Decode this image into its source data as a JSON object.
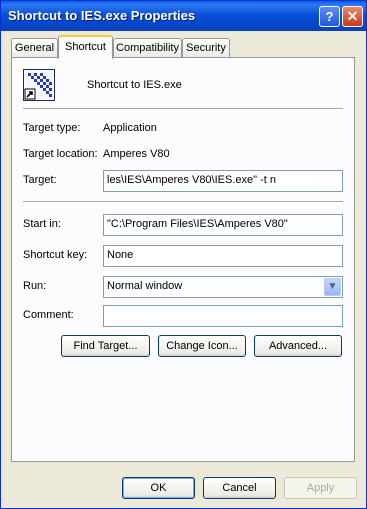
{
  "window": {
    "title": "Shortcut to IES.exe Properties",
    "help_glyph": "?",
    "close_glyph": "✕"
  },
  "tabs": [
    {
      "label": "General"
    },
    {
      "label": "Shortcut"
    },
    {
      "label": "Compatibility"
    },
    {
      "label": "Security"
    }
  ],
  "header": {
    "icon": "ies-app-shortcut-icon",
    "name": "Shortcut to IES.exe"
  },
  "details": {
    "target_type_label": "Target type:",
    "target_type_value": "Application",
    "target_location_label": "Target location:",
    "target_location_value": "Amperes V80",
    "target_label": "Target:",
    "target_value": "les\\IES\\Amperes V80\\IES.exe\" -t n"
  },
  "settings": {
    "start_in_label": "Start in:",
    "start_in_value": "\"C:\\Program Files\\IES\\Amperes V80\"",
    "shortcut_key_label": "Shortcut key:",
    "shortcut_key_value": "None",
    "run_label": "Run:",
    "run_value": "Normal window",
    "comment_label": "Comment:",
    "comment_value": ""
  },
  "actions": {
    "find_target": "Find Target...",
    "change_icon": "Change Icon...",
    "advanced": "Advanced..."
  },
  "footer": {
    "ok": "OK",
    "cancel": "Cancel",
    "apply": "Apply"
  }
}
